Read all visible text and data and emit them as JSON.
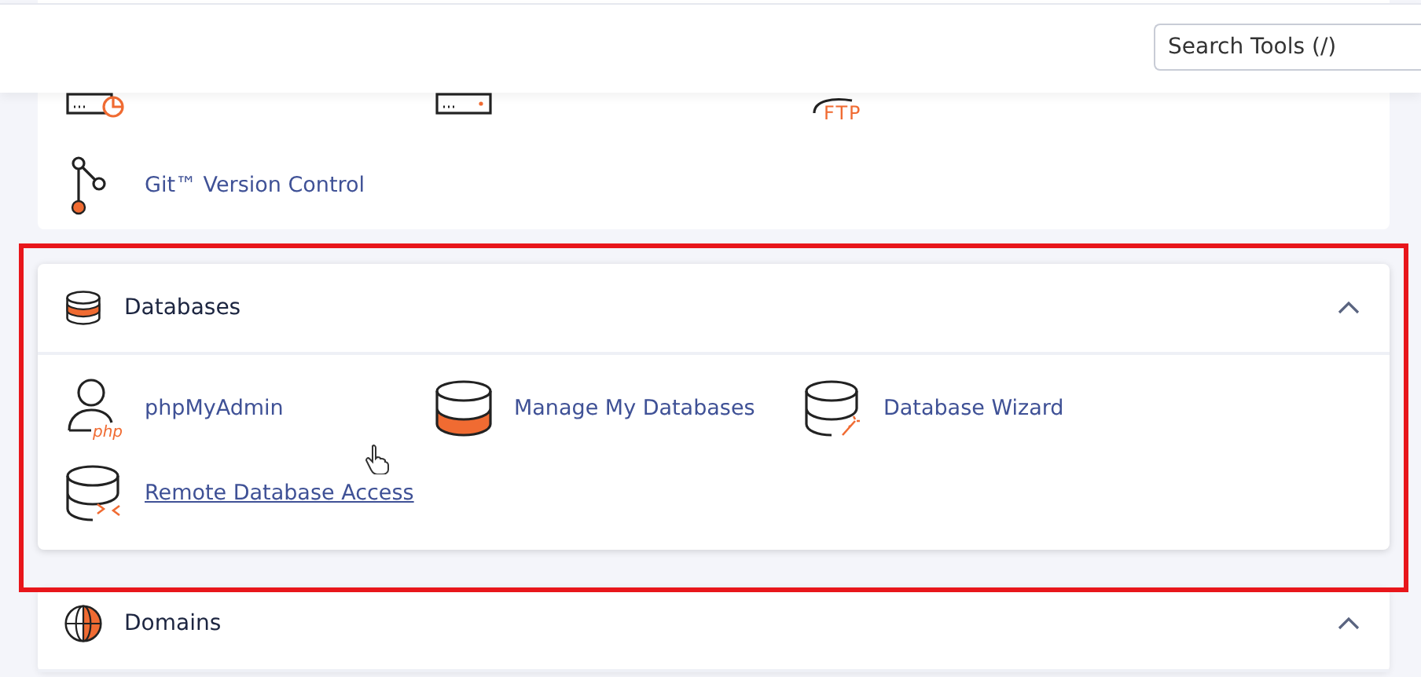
{
  "header": {
    "search": {
      "placeholder": "Search Tools (/)"
    }
  },
  "files_section": {
    "items": [
      {
        "kind": "disk-usage"
      },
      {
        "kind": "web-disk"
      },
      {
        "kind": "ftp",
        "badge": "FTP"
      },
      {
        "kind": "git",
        "label": "Git™ Version Control",
        "hovered": false
      }
    ]
  },
  "databases_section": {
    "title": "Databases",
    "expanded": true,
    "highlighted": true,
    "items": [
      {
        "kind": "person",
        "badge": "php",
        "label": "phpMyAdmin",
        "hovered": false
      },
      {
        "kind": "database-filled",
        "label": "Manage My Databases",
        "hovered": false
      },
      {
        "kind": "database-wizard",
        "label": "Database Wizard",
        "hovered": false
      },
      {
        "kind": "database-remote",
        "label": "Remote Database Access",
        "hovered": true
      }
    ]
  },
  "domains_section": {
    "title": "Domains",
    "expanded": true
  }
}
